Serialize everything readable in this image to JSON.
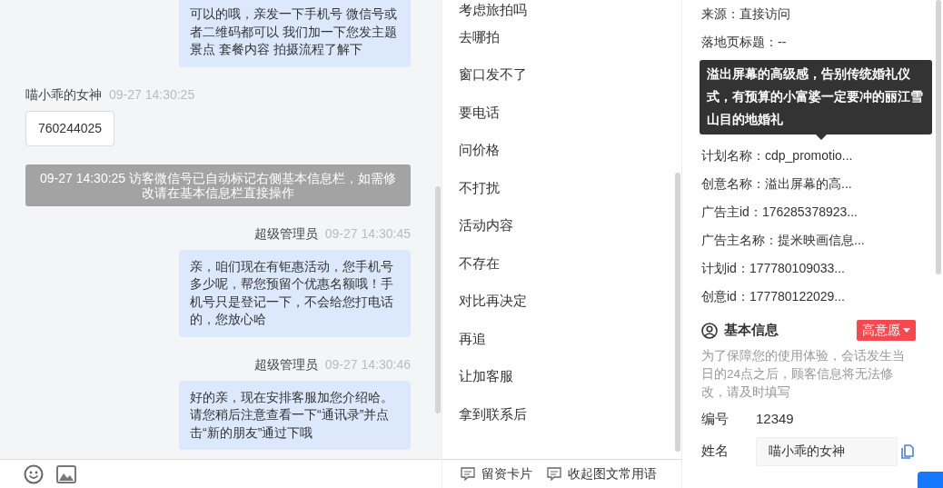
{
  "chat": {
    "messages": [
      {
        "kind": "agent",
        "text": "可以的哦，亲发一下手机号 微信号或者二维码都可以 我们加一下您发主题景点 套餐内容 拍摄流程了解下"
      },
      {
        "kind": "visitor",
        "sender": "喵小乖的女神",
        "time": "09-27 14:30:25",
        "text": "760244025"
      },
      {
        "kind": "system",
        "text": "09-27 14:30:25 访客微信号已自动标记右侧基本信息栏，如需修改请在基本信息栏直接操作"
      },
      {
        "kind": "agent",
        "sender": "超级管理员",
        "time": "09-27 14:30:45",
        "text": "亲，咱们现在有钜惠活动，您手机号多少呢，帮您预留个优惠名额哦！手机号只是登记一下，不会给您打电话的，您放心哈"
      },
      {
        "kind": "agent",
        "sender": "超级管理员",
        "time": "09-27 14:30:46",
        "text": "好的亲，现在安排客服加您介绍哈。请您稍后注意查看一下“通讯录”并点击“新的朋友”通过下哦"
      }
    ]
  },
  "phrases": {
    "items": [
      "考虑旅拍吗",
      "去哪拍",
      "窗口发不了",
      "要电话",
      "问价格",
      "不打扰",
      "活动内容",
      "不存在",
      "对比再决定",
      "再追",
      "让加客服",
      "拿到联系后"
    ]
  },
  "footer_actions": [
    {
      "label": "留资卡片"
    },
    {
      "label": "收起图文常用语"
    }
  ],
  "visit_info": {
    "rows_before_tooltip": [
      "来源：直接访问",
      "落地页标题：--"
    ],
    "tooltip": "溢出屏幕的高级感，告别传统婚礼仪式，有预算的小富婆一定要冲的丽江雪山目的地婚礼",
    "rows_after_tooltip": [
      "计划名称：cdp_promotio...",
      "创意名称：溢出屏幕的高...",
      "广告主id：176285378923...",
      "广告主名称：提米映画信息...",
      "计划id：177780109033...",
      "创意id：177780122029..."
    ]
  },
  "basic_info": {
    "title": "基本信息",
    "intent": "高意愿",
    "note": "为了保障您的使用体验，会话发生当日的24点之后，顾客信息将无法修改，请及时填写",
    "fields": [
      {
        "kind": "text",
        "label": "编号",
        "value": "12349"
      },
      {
        "kind": "input",
        "label": "姓名",
        "value": "喵小乖的女神"
      }
    ]
  }
}
